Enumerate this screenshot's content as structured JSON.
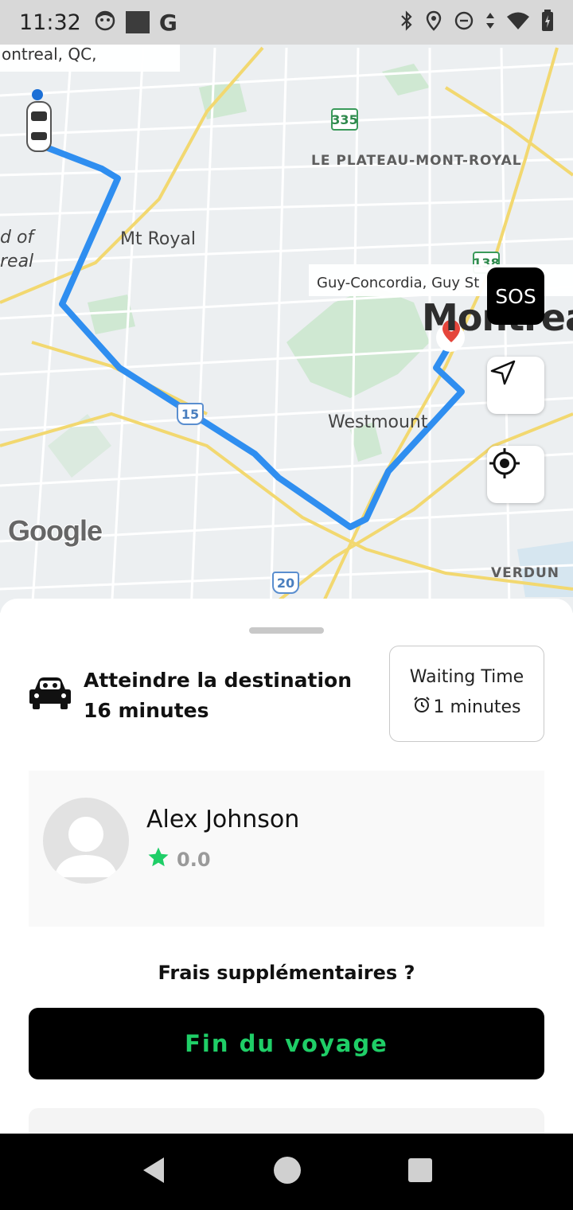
{
  "status_bar": {
    "time": "11:32",
    "left_icons": [
      "face-icon",
      "square-icon",
      "google-icon"
    ],
    "right_icons": [
      "bluetooth-icon",
      "location-icon",
      "dnd-icon",
      "data-arrows-icon",
      "wifi-icon",
      "battery-icon"
    ]
  },
  "map": {
    "top_address": "ontreal, QC,",
    "labels": {
      "plateau": "LE PLATEAU-MONT-ROYAL",
      "mt_royal": "Mt Royal",
      "left_d_of": "d of",
      "left_real": "real",
      "westmount": "Westmount",
      "verdun": "VERDUN"
    },
    "place_chip": "Guy-Concordia, Guy St",
    "city": "Montreal",
    "shields": {
      "a": "335",
      "b": "138",
      "c": "15",
      "d": "20"
    },
    "google_logo": "Google",
    "sos_label": "SOS"
  },
  "sheet": {
    "eta_text": "Atteindre la destination 16 minutes",
    "waiting_title": "Waiting Time",
    "waiting_value": "1 minutes",
    "driver": {
      "name": "Alex Johnson",
      "rating": "0.0"
    },
    "extra_fees": "Frais supplémentaires ?",
    "end_trip": "Fin du voyage"
  },
  "colors": {
    "route": "#2f8ef0",
    "accent_green": "#1fce67",
    "star": "#1fce67"
  }
}
